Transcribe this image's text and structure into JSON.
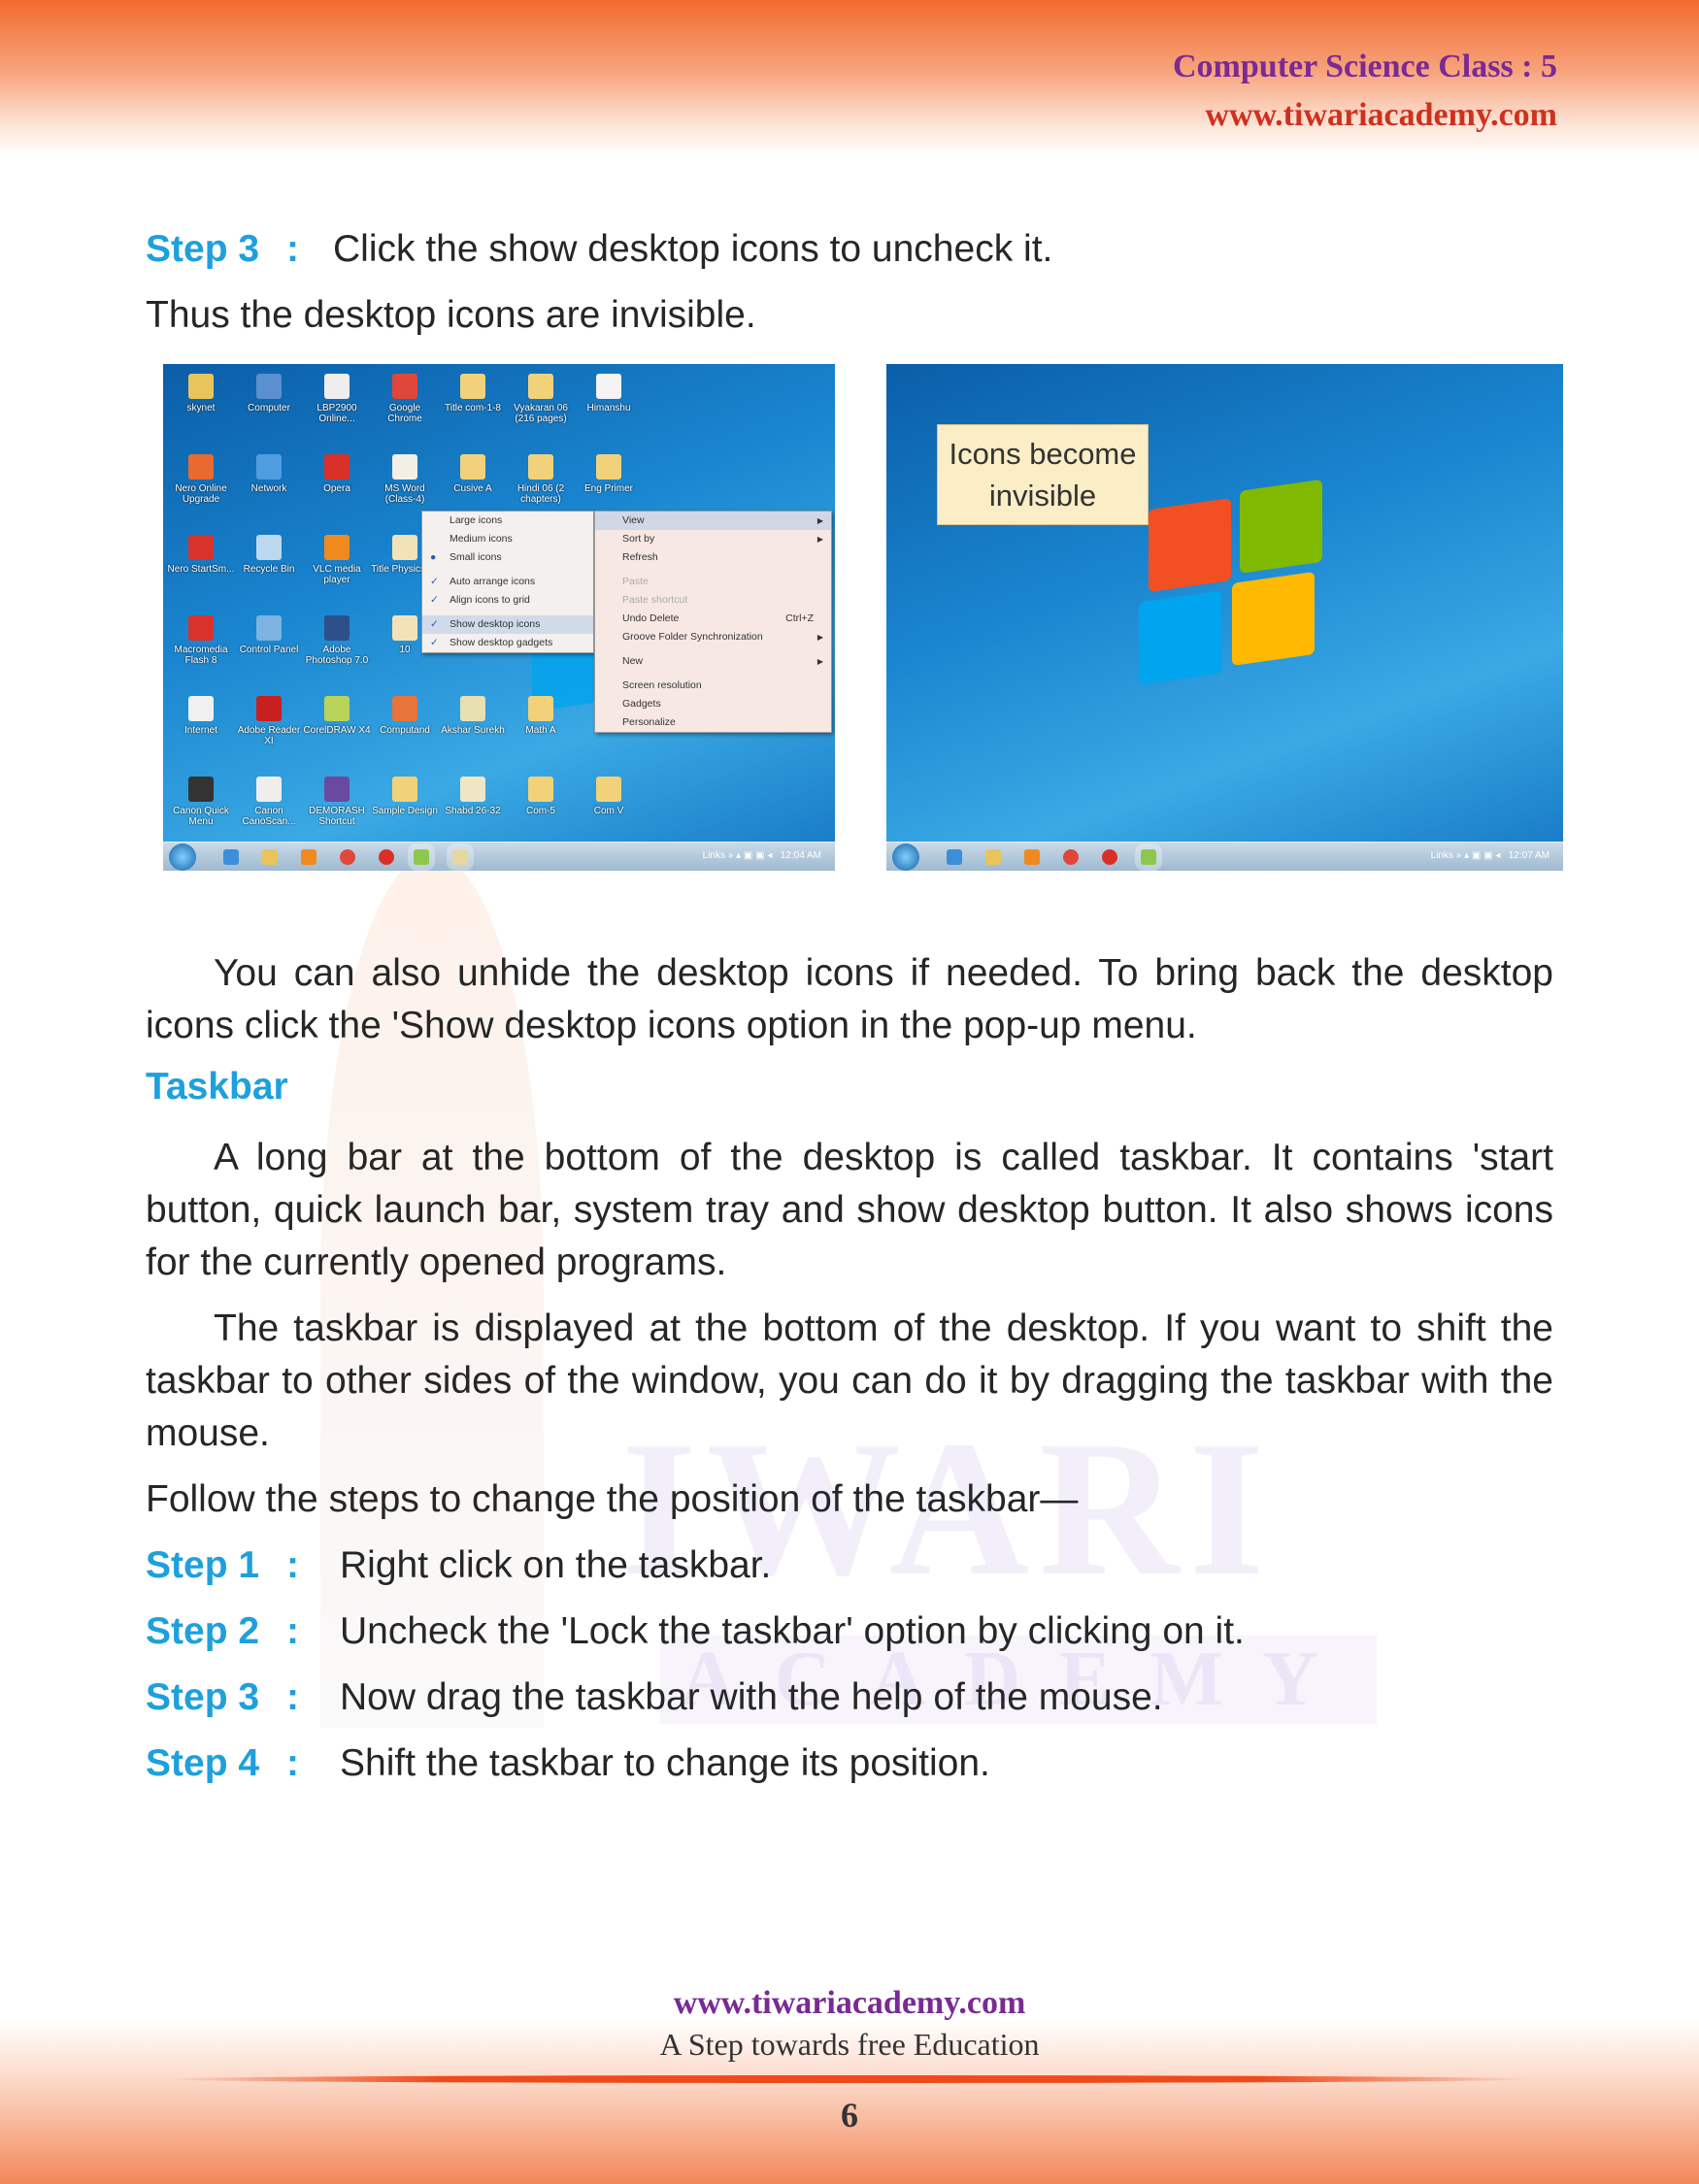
{
  "header": {
    "title": "Computer Science Class : 5",
    "url": "www.tiwariacademy.com"
  },
  "watermark": {
    "line1": "IWARI",
    "line2": "A C A D E M Y"
  },
  "intro": {
    "step3_label": "Step 3",
    "colon": ":",
    "step3_text": "Click the show desktop icons to uncheck it.",
    "result": "Thus the desktop icons are invisible."
  },
  "left_screenshot": {
    "icons": [
      {
        "label": "skynet",
        "color": "#e9c45a"
      },
      {
        "label": "Computer",
        "color": "#5a8fd0"
      },
      {
        "label": "LBP2900 Online...",
        "color": "#eeeeee"
      },
      {
        "label": "Google Chrome",
        "color": "#e0473a"
      },
      {
        "label": "Title com-1-8",
        "color": "#f1d27a"
      },
      {
        "label": "Vyakaran 06 (216 pages)",
        "color": "#f1d27a"
      },
      {
        "label": "Himanshu",
        "color": "#f4f4f4"
      },
      {
        "label": "Nero Online Upgrade",
        "color": "#e86a30"
      },
      {
        "label": "Network",
        "color": "#4f9de0"
      },
      {
        "label": "Opera",
        "color": "#d9302a"
      },
      {
        "label": "MS Word (Class-4)",
        "color": "#f1efe6"
      },
      {
        "label": "Cusive A",
        "color": "#f1d27a"
      },
      {
        "label": "Hindi 06 (2 chapters)",
        "color": "#f1d27a"
      },
      {
        "label": "Eng Primer",
        "color": "#f1d27a"
      },
      {
        "label": "Nero StartSm...",
        "color": "#d8322a"
      },
      {
        "label": "Recycle Bin",
        "color": "#bcd8ee"
      },
      {
        "label": "VLC media player",
        "color": "#f08a1e"
      },
      {
        "label": "Title Physics 06",
        "color": "#f3e2b8"
      },
      {
        "label": "",
        "color": ""
      },
      {
        "label": "",
        "color": ""
      },
      {
        "label": "",
        "color": ""
      },
      {
        "label": "Macromedia Flash 8",
        "color": "#d8322a"
      },
      {
        "label": "Control Panel",
        "color": "#7cb3e0"
      },
      {
        "label": "Adobe Photoshop 7.0",
        "color": "#2d4f8a"
      },
      {
        "label": "10",
        "color": "#f3e2b8"
      },
      {
        "label": "",
        "color": ""
      },
      {
        "label": "",
        "color": ""
      },
      {
        "label": "",
        "color": ""
      },
      {
        "label": "Internet",
        "color": "#f0f0f0"
      },
      {
        "label": "Adobe Reader XI",
        "color": "#c8201e"
      },
      {
        "label": "CorelDRAW X4",
        "color": "#b9d35a"
      },
      {
        "label": "Computand",
        "color": "#e7743a"
      },
      {
        "label": "Akshar Surekh",
        "color": "#e8e0b0"
      },
      {
        "label": "Math A",
        "color": "#f1d27a"
      },
      {
        "label": "",
        "color": ""
      },
      {
        "label": "Canon Quick Menu",
        "color": "#333333"
      },
      {
        "label": "Canon CanoScan...",
        "color": "#eeeeee"
      },
      {
        "label": "DEMORASH Shortcut",
        "color": "#6a4aa0"
      },
      {
        "label": "Sample Design",
        "color": "#f1d27a"
      },
      {
        "label": "Shabd 26-32",
        "color": "#efe6c6"
      },
      {
        "label": "Com-5",
        "color": "#f1d27a"
      },
      {
        "label": "Com V",
        "color": "#f1d27a"
      }
    ],
    "view_submenu": [
      {
        "label": "Large icons",
        "mark": ""
      },
      {
        "label": "Medium icons",
        "mark": ""
      },
      {
        "label": "Small icons",
        "mark": "●"
      },
      {
        "sep": true
      },
      {
        "label": "Auto arrange icons",
        "mark": "✓"
      },
      {
        "label": "Align icons to grid",
        "mark": "✓"
      },
      {
        "sep": true
      },
      {
        "label": "Show desktop icons",
        "mark": "✓",
        "highlight": true
      },
      {
        "label": "Show desktop gadgets",
        "mark": "✓"
      }
    ],
    "context_menu": [
      {
        "label": "View",
        "arrow": true,
        "highlight": true
      },
      {
        "label": "Sort by",
        "arrow": true
      },
      {
        "label": "Refresh"
      },
      {
        "sep": true
      },
      {
        "label": "Paste",
        "disabled": true
      },
      {
        "label": "Paste shortcut",
        "disabled": true
      },
      {
        "label": "Undo Delete",
        "shortcut": "Ctrl+Z"
      },
      {
        "label": "Groove Folder Synchronization",
        "arrow": true
      },
      {
        "sep": true
      },
      {
        "label": "New",
        "arrow": true
      },
      {
        "sep": true
      },
      {
        "label": "Screen resolution"
      },
      {
        "label": "Gadgets"
      },
      {
        "label": "Personalize"
      }
    ],
    "tray": {
      "links": "Links",
      "time": "12:04 AM"
    }
  },
  "right_screenshot": {
    "callout": "Icons become invisible",
    "tray": {
      "links": "Links",
      "time": "12:07 AM"
    }
  },
  "body": {
    "para1": "You can also unhide the desktop icons if needed. To bring back the desktop icons click the 'Show desktop icons option in the pop-up menu.",
    "heading": "Taskbar",
    "para2": "A long bar at the bottom of the desktop is called taskbar. It contains 'start button, quick launch bar, system tray and show desktop button. It also shows icons for the currently opened programs.",
    "para3": "The taskbar is displayed at the bottom of the desktop. If you want to shift the taskbar to other sides of the window, you can do it by dragging the taskbar with the mouse.",
    "para4": "Follow the steps to change the position of the taskbar—",
    "steps": [
      {
        "label": "Step 1",
        "text": "Right click on the taskbar."
      },
      {
        "label": "Step 2",
        "text": "Uncheck the 'Lock the taskbar' option by clicking on it."
      },
      {
        "label": "Step 3",
        "text": "Now drag the taskbar with the help of the mouse."
      },
      {
        "label": "Step 4",
        "text": "Shift the taskbar to change its position."
      }
    ]
  },
  "footer": {
    "url": "www.tiwariacademy.com",
    "tagline": "A Step towards free Education",
    "page": "6"
  },
  "colors": {
    "accent": "#1ea0dc",
    "header_purple": "#7a2a94",
    "band_orange": "#f26a2e"
  }
}
